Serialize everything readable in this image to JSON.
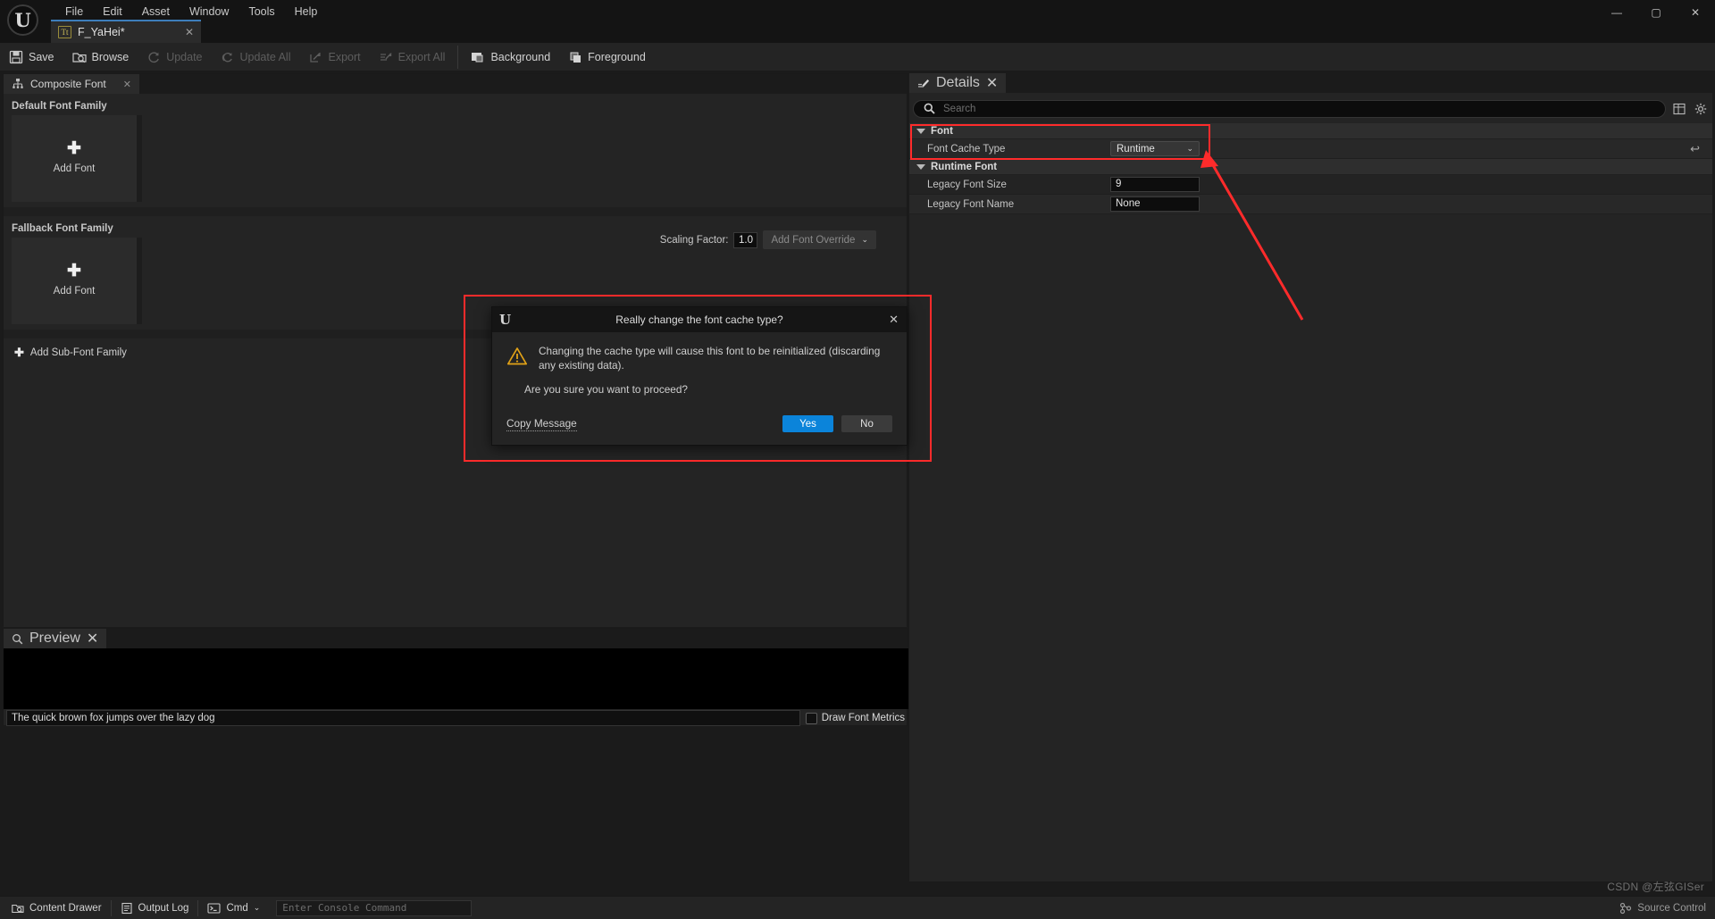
{
  "window": {
    "title": "Unreal Engine Font Editor",
    "logo_glyph": "U",
    "controls": {
      "minimize": "—",
      "maximize": "▢",
      "close": "✕"
    }
  },
  "menu": {
    "items": [
      {
        "label": "File"
      },
      {
        "label": "Edit"
      },
      {
        "label": "Asset"
      },
      {
        "label": "Window"
      },
      {
        "label": "Tools"
      },
      {
        "label": "Help"
      }
    ]
  },
  "asset_tab": {
    "icon": "Tt",
    "label": "F_YaHei*",
    "close": "✕"
  },
  "toolbar": {
    "buttons": [
      {
        "label": "Save",
        "icon": "save-icon",
        "disabled": false
      },
      {
        "label": "Browse",
        "icon": "browse-icon",
        "disabled": false
      },
      {
        "label": "Update",
        "icon": "update-icon",
        "disabled": true
      },
      {
        "label": "Update All",
        "icon": "update-all-icon",
        "disabled": true
      },
      {
        "label": "Export",
        "icon": "export-icon",
        "disabled": true
      },
      {
        "label": "Export All",
        "icon": "export-all-icon",
        "disabled": true
      },
      {
        "label": "Background",
        "icon": "background-icon",
        "disabled": false
      },
      {
        "label": "Foreground",
        "icon": "foreground-icon",
        "disabled": false
      }
    ]
  },
  "composite_font": {
    "tab_label": "Composite Font",
    "tab_close": "✕",
    "default_family_title": "Default Font Family",
    "fallback_family_title": "Fallback Font Family",
    "add_font_label": "Add Font",
    "plus_glyph": "✚",
    "add_subfont_label": "Add Sub-Font Family",
    "scaling_factor_label": "Scaling Factor:",
    "scaling_factor_value": "1.0",
    "add_font_override_label": "Add Font Override",
    "chevron": "⌄"
  },
  "preview": {
    "tab_label": "Preview",
    "tab_close": "✕",
    "sample_text": "The quick brown fox jumps over the lazy dog",
    "draw_font_metrics_label": "Draw Font Metrics",
    "draw_font_metrics_checked": false
  },
  "details": {
    "tab_label": "Details",
    "tab_close": "✕",
    "search_placeholder": "Search",
    "groups": [
      {
        "name": "Font",
        "rows": [
          {
            "name": "Font Cache Type",
            "value": "Runtime",
            "control": "dropdown",
            "has_reset": true
          }
        ]
      },
      {
        "name": "Runtime Font",
        "rows": [
          {
            "name": "Legacy Font Size",
            "value": "9",
            "control": "text"
          },
          {
            "name": "Legacy Font Name",
            "value": "None",
            "control": "text"
          }
        ]
      }
    ]
  },
  "dialog": {
    "title": "Really change the font cache type?",
    "close": "✕",
    "message_line1": "Changing the cache type will cause this font to be reinitialized (discarding any existing data).",
    "message_line2": "Are you sure you want to proceed?",
    "copy_message_label": "Copy Message",
    "yes_label": "Yes",
    "no_label": "No",
    "warning_icon": "warning-triangle-icon"
  },
  "statusbar": {
    "content_drawer_label": "Content Drawer",
    "output_log_label": "Output Log",
    "cmd_label": "Cmd",
    "cmd_chevron": "⌄",
    "console_placeholder": "Enter Console Command",
    "source_control_label": "Source Control"
  },
  "watermark": {
    "text": "CSDN @左弦GISer"
  },
  "colors": {
    "accent_blue": "#0b84da",
    "highlight_red": "#ff2b2b",
    "warning_yellow": "#e3a317",
    "panel_bg": "#242424",
    "window_bg": "#1b1b1b",
    "tab_active": "#2b2b2b"
  }
}
